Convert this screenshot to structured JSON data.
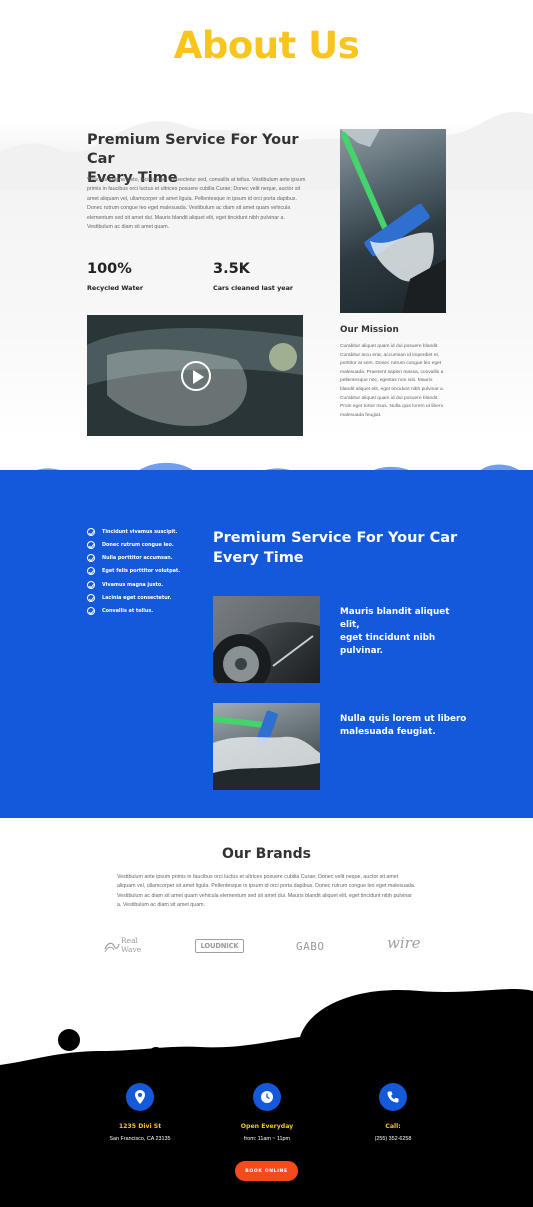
{
  "colors": {
    "accent_yellow": "#f9c41c",
    "brand_blue": "#1359d9",
    "button_orange": "#f24c1a",
    "footer_black": "#000000"
  },
  "hero": {
    "title": "About Us"
  },
  "intro": {
    "heading_line1": "Premium Service For Your Car",
    "heading_line2": "Every Time",
    "paragraph": "Vivamus magna justo, lacinia eget consectetur sed, convallis at tellus. Vestibulum ante ipsum primis in faucibus orci luctus et ultrices posuere cubilia Curae; Donec velit neque, auctor sit amet aliquam vel, ullamcorper sit amet ligula. Pellentesque in ipsum id orci porta dapibus. Donec rutrum congue leo eget malesuada. Vestibulum ac diam sit amet quam vehicula elementum sed sit amet dui. Mauris blandit aliquet elit, eget tincidunt nibh pulvinar a. Vestibulum ac diam sit amet quam.",
    "stats": [
      {
        "value": "100%",
        "label": "Recycled Water"
      },
      {
        "value": "3.5K",
        "label": "Cars cleaned last year"
      }
    ],
    "video_play_icon": "play-icon"
  },
  "mission": {
    "title": "Our Mission",
    "paragraph": "Curabitur aliquet quam id dui posuere blandit. Curabitur arcu erat, accumsan id imperdiet et, porttitor at sem. Donec rutrum congue leo eget malesuada. Praesent sapien massa, convallis a pellentesque nec, egestas non nisi. Mauris blandit aliquet elit, eget tincidunt nibh pulvinar a. Curabitur aliquet quam id dui posuere blandit. Proin eget tortor risus. Nulla quis lorem ut libero malesuada feugiat."
  },
  "features": {
    "checklist": [
      "Tincidunt vivamus suscipit.",
      "Donec rutrum congue leo.",
      "Nulla porttitor accumsan.",
      "Eget felis porttitor volutpat.",
      "Vivamus magna justo.",
      "Lacinia eget consectetur.",
      "Convallis at tellus."
    ],
    "heading_line1": "Premium Service For Your Car",
    "heading_line2": "Every Time",
    "items": [
      {
        "line1": "Mauris blandit aliquet elit,",
        "line2": "eget tincidunt nibh",
        "line3": "pulvinar."
      },
      {
        "line1": "Nulla quis lorem ut libero",
        "line2": "malesuada feugiat."
      }
    ]
  },
  "brands": {
    "title": "Our Brands",
    "paragraph": "Vestibulum ante ipsum primis in faucibus orci luctus et ultrices posuere cubilia Curae; Donec velit neque, auctor sit amet aliquam vel, ullamcorper sit amet ligula. Pellentesque in ipsum id orci porta dapibus. Donec rutrum congue leo eget malesuada. Vestibulum ac diam sit amet quam vehicula elementum sed sit amet dui. Mauris blandit aliquet elit, eget tincidunt nibh pulvinar a. Vestibulum ac diam sit amet quam.",
    "logos": [
      {
        "line1": "Real",
        "line2": "Wave"
      },
      {
        "text": "LOUDNICK"
      },
      {
        "text": "GABO"
      },
      {
        "text": "wire"
      }
    ]
  },
  "footer": {
    "columns": [
      {
        "icon": "location-pin-icon",
        "title": "1235 Divi St",
        "sub": "San Francisco, CA 23135"
      },
      {
        "icon": "clock-icon",
        "title": "Open Everyday",
        "sub": "from: 11am ~ 11pm"
      },
      {
        "icon": "phone-icon",
        "title": "Call:",
        "sub": "(255) 352-6258"
      }
    ],
    "button_label": "BOOK ONLINE"
  }
}
